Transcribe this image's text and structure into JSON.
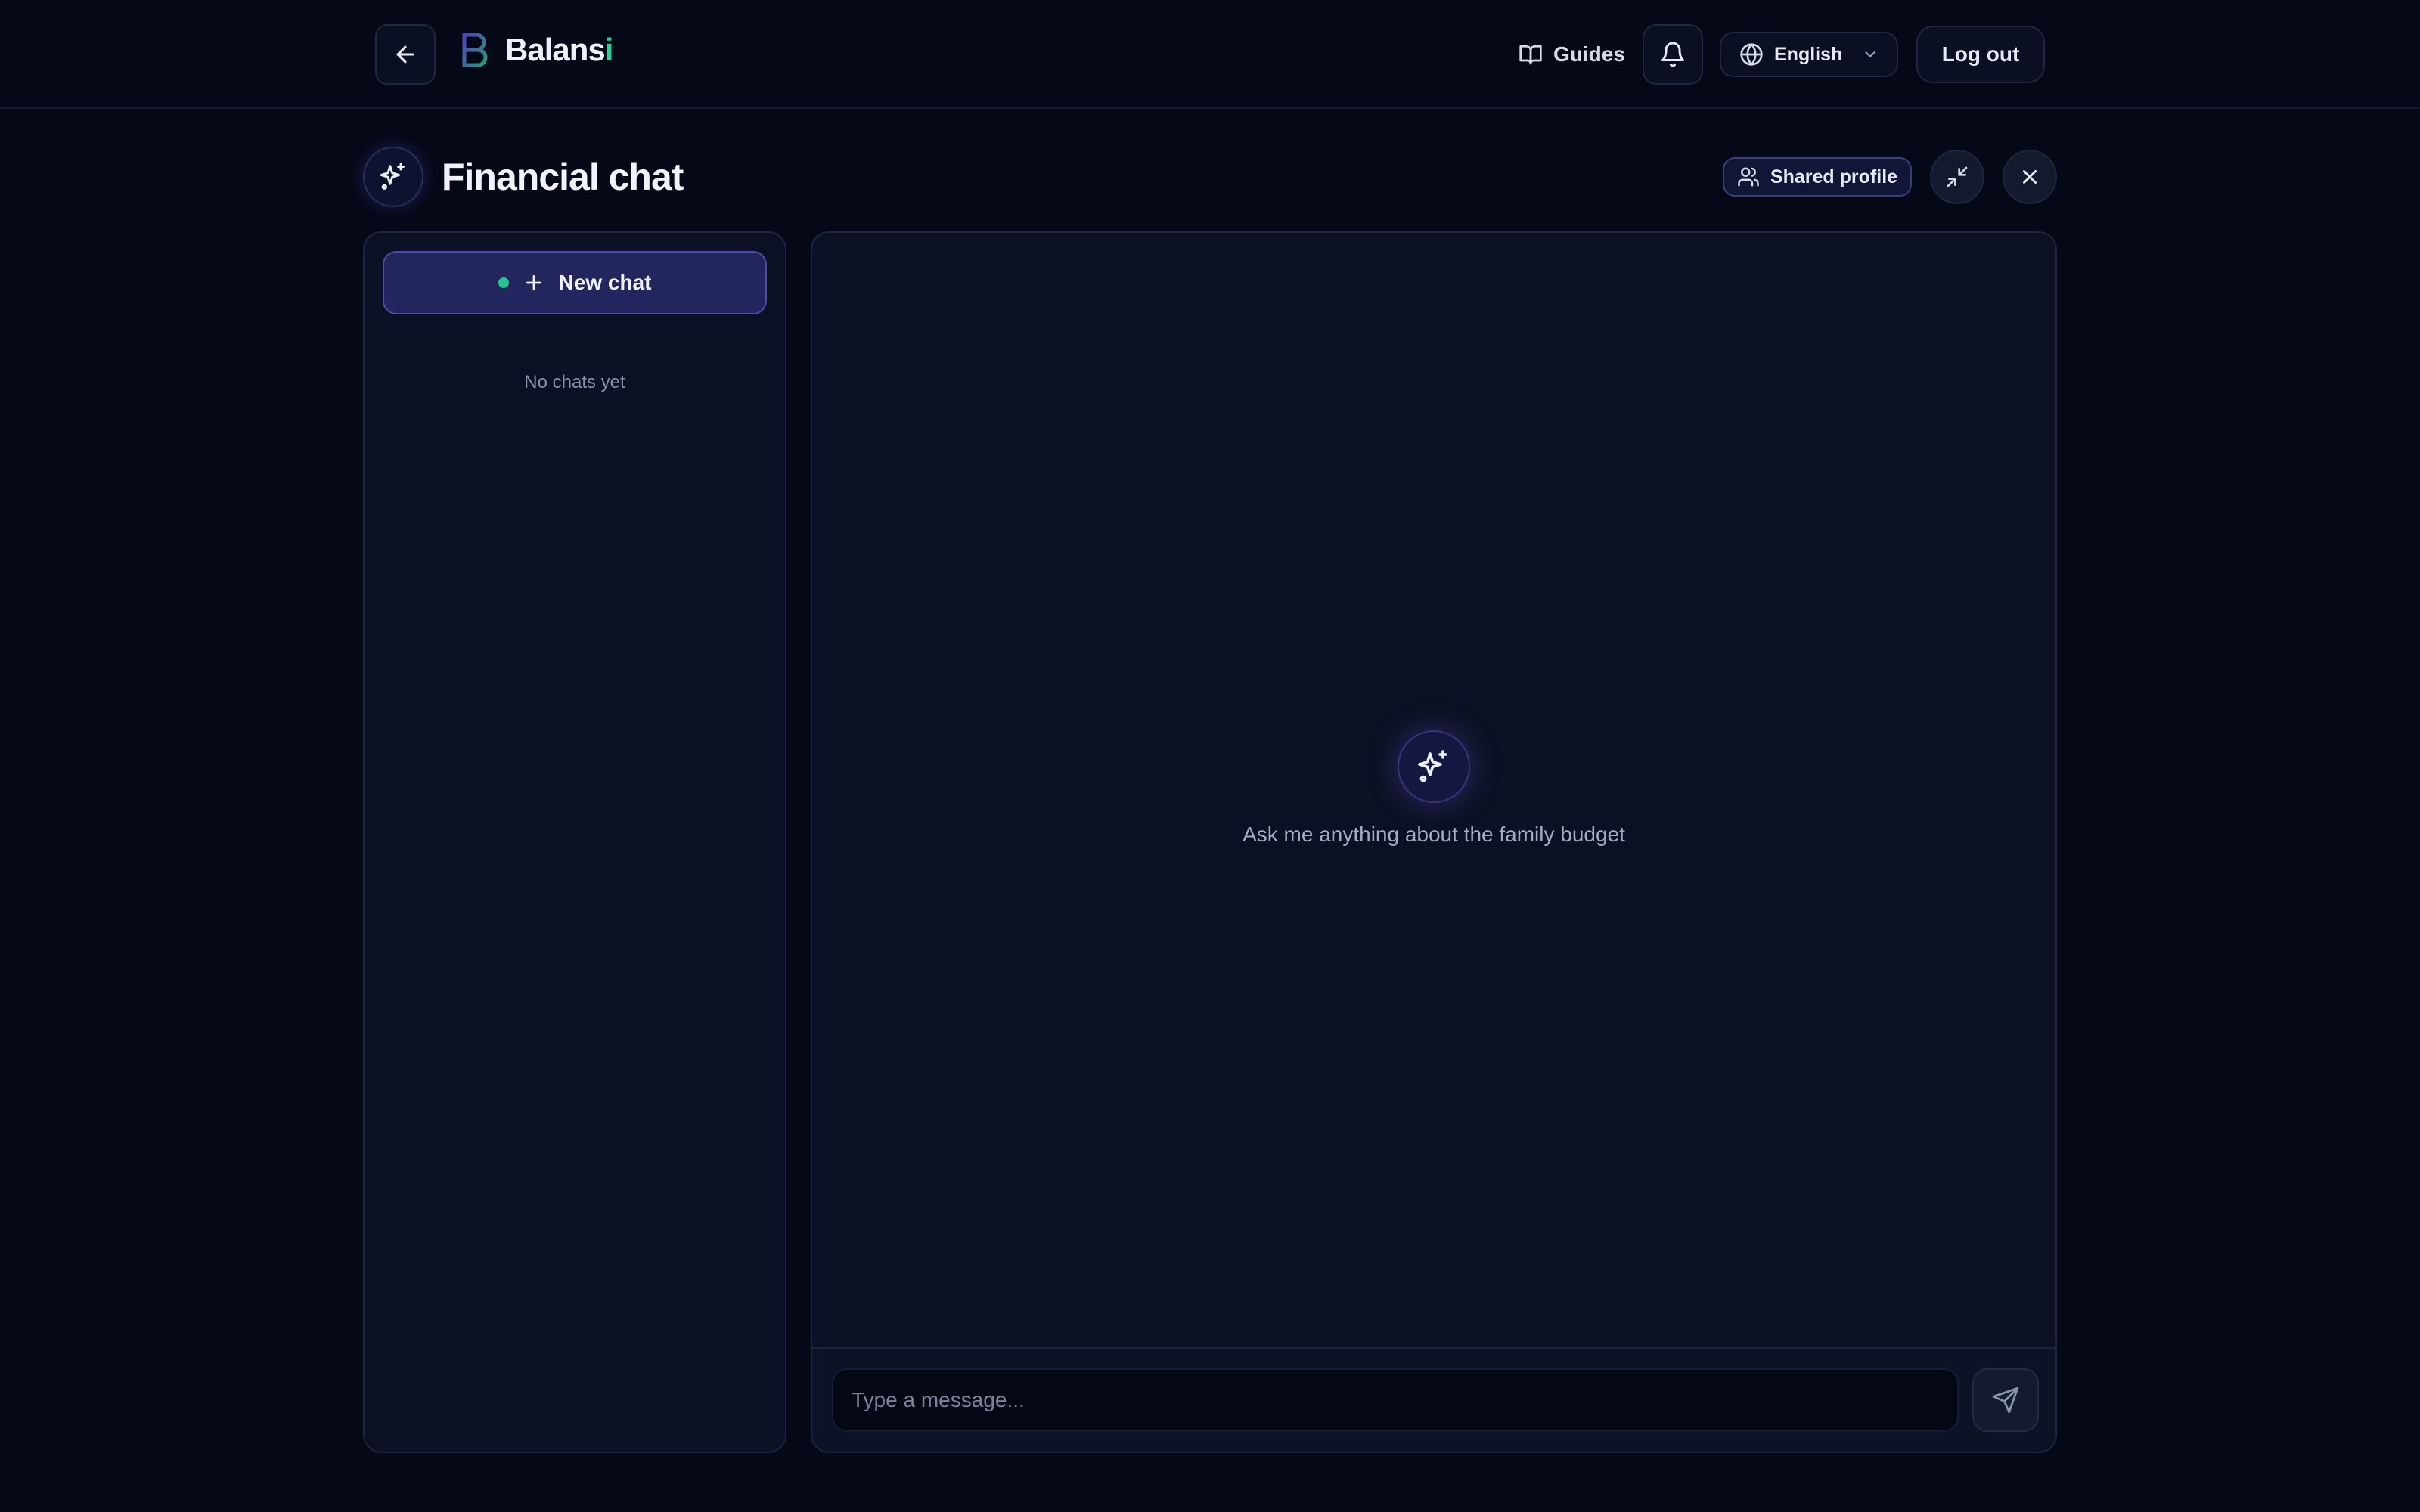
{
  "app": {
    "brand_prefix": "Balans",
    "brand_accent": "i",
    "accent_color": "#22d39a",
    "primary_color": "#23265e"
  },
  "topbar": {
    "guides_label": "Guides",
    "language_label": "English",
    "logout_label": "Log out",
    "icons": [
      "arrow-left-icon",
      "book-open-icon",
      "bell-icon",
      "globe-icon",
      "chevron-down-icon"
    ]
  },
  "page": {
    "title": "Financial chat",
    "shared_profile_label": "Shared profile",
    "icons": [
      "sparkles-icon",
      "users-icon",
      "minimize-icon",
      "close-icon"
    ]
  },
  "sidebar": {
    "new_chat_label": "New chat",
    "empty_label": "No chats yet"
  },
  "chat": {
    "empty_prompt": "Ask me anything about the family budget",
    "input_placeholder": "Type a message...",
    "input_value": "",
    "icons": [
      "sparkles-icon",
      "send-icon"
    ]
  }
}
